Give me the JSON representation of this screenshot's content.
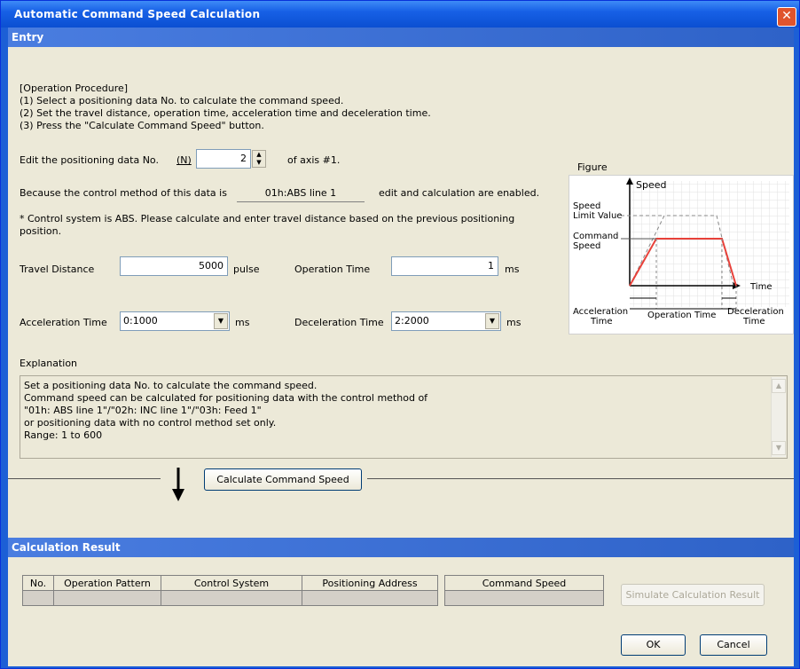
{
  "window": {
    "title": "Automatic Command Speed Calculation",
    "close_icon": "close-icon"
  },
  "entry": {
    "header": "Entry",
    "procedure": [
      "[Operation Procedure]",
      "(1) Select a positioning data No. to calculate the command speed.",
      "(2) Set the travel distance, operation time, acceleration time and deceleration time.",
      "(3) Press the \"Calculate Command Speed\" button."
    ],
    "edit_label": "Edit the positioning data No.",
    "edit_hotkey": "(N)",
    "edit_value": "2",
    "edit_suffix": "of axis #1.",
    "control_prefix": "Because the control method of this data is",
    "control_value": "01h:ABS line 1",
    "control_suffix": "edit and calculation are enabled.",
    "note_line1": "* Control system is ABS. Please calculate and enter travel distance based on the previous positioning",
    "note_line2": "position.",
    "travel_label": "Travel Distance",
    "travel_value": "5000",
    "travel_unit": "pulse",
    "optime_label": "Operation Time",
    "optime_value": "1",
    "optime_unit": "ms",
    "accel_label": "Acceleration Time",
    "accel_value": "0:1000",
    "accel_unit": "ms",
    "decel_label": "Deceleration Time",
    "decel_value": "2:2000",
    "decel_unit": "ms",
    "explanation_label": "Explanation",
    "explanation_lines": [
      "Set a positioning data No. to calculate the command speed.",
      "Command speed can be calculated for positioning data with the control method of",
      "\"01h: ABS line 1\"/\"02h: INC line 1\"/\"03h: Feed 1\"",
      "or positioning data with no control method set only.",
      "Range: 1 to 600"
    ],
    "calc_button": "Calculate Command Speed"
  },
  "figure": {
    "label": "Figure",
    "speed": "Speed",
    "limit_line1": "Speed",
    "limit_line2": "Limit Value",
    "command_line1": "Command",
    "command_line2": "Speed",
    "time": "Time",
    "accel_line1": "Acceleration",
    "accel_line2": "Time",
    "optime": "Operation Time",
    "decel_line1": "Deceleration",
    "decel_line2": "Time",
    "profile_color": "#e8413a"
  },
  "result": {
    "header": "Calculation Result",
    "columns": [
      "No.",
      "Operation Pattern",
      "Control System",
      "Positioning Address"
    ],
    "speed_column": "Command Speed",
    "simulate_button": "Simulate Calculation Result",
    "ok_button": "OK",
    "cancel_button": "Cancel"
  }
}
